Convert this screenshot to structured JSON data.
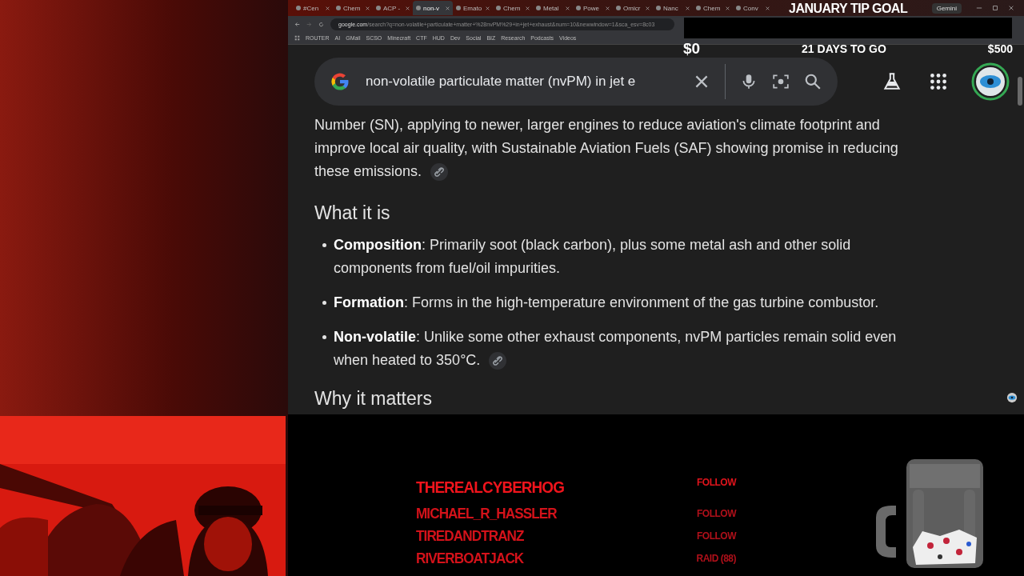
{
  "browser": {
    "tabs": [
      {
        "label": "#Cen",
        "selected": false
      },
      {
        "label": "Chem",
        "selected": false
      },
      {
        "label": "ACP -",
        "selected": false
      },
      {
        "label": "non-v",
        "selected": true
      },
      {
        "label": "Emato",
        "selected": false
      },
      {
        "label": "Chem",
        "selected": false
      },
      {
        "label": "Metal",
        "selected": false
      },
      {
        "label": "Powe",
        "selected": false
      },
      {
        "label": "Omicr",
        "selected": false
      },
      {
        "label": "Nanc",
        "selected": false
      },
      {
        "label": "Chem",
        "selected": false
      },
      {
        "label": "Conv",
        "selected": false
      }
    ],
    "gemini": "Gemini",
    "url_host": "google.com",
    "url_path": "/search?q=non-volatile+particulate+matter+%28nvPM%29+in+jet+exhaust&num=10&newwindow=1&sca_esv=8c03",
    "bookmarks": [
      "ROUTER",
      "AI",
      "GMail",
      "SCSO",
      "Minecraft",
      "CTF",
      "HUD",
      "Dev",
      "Social",
      "BIZ",
      "Research",
      "Podcasts",
      "Videos"
    ]
  },
  "search": {
    "value": "non-volatile particulate matter (nvPM) in jet e"
  },
  "content": {
    "intro": "Number (SN), applying to newer, larger engines to reduce aviation's climate footprint and improve local air quality, with Sustainable Aviation Fuels (SAF) showing promise in reducing these emissions.",
    "heading": "What it is",
    "bullets": [
      {
        "text": "**Composition**: Primarily soot (black carbon), plus some metal ash and other solid components from fuel/oil impurities.",
        "link": false
      },
      {
        "text": "**Formation**: Forms in the high-temperature environment of the gas turbine combustor.",
        "link": false
      },
      {
        "text": "**Non-volatile**: Unlike some other exhaust components, nvPM particles remain solid even when heated to 350°C.",
        "link": true
      }
    ],
    "next_heading": "Why it matters"
  },
  "tip_goal": {
    "title": "JANUARY TIP GOAL",
    "start": "$0",
    "days_left": "21 DAYS TO GO",
    "target": "$500"
  },
  "events": [
    {
      "name": "THEREALCYBERHOG",
      "action": "FOLLOW",
      "latest": true
    },
    {
      "name": "MICHAEL_R_HASSLER",
      "action": "FOLLOW",
      "latest": false
    },
    {
      "name": "TIREDANDTRANZ",
      "action": "FOLLOW",
      "latest": false
    },
    {
      "name": "RIVERBOATJACK",
      "action": "RAID (88)",
      "latest": false
    }
  ]
}
